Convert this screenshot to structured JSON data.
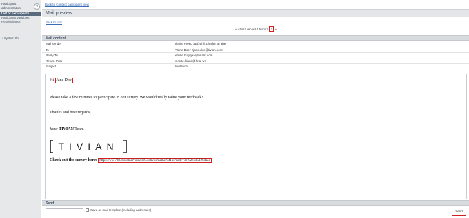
{
  "sidebar": {
    "items": [
      {
        "label": "Participant"
      },
      {
        "label": "administration"
      },
      {
        "label": "List of participants"
      },
      {
        "label": "Participant variables"
      },
      {
        "label": "Results import"
      }
    ],
    "collapse_label": "«",
    "system_label": "› System Ifo"
  },
  "header": {
    "back_contact": "Back to Contact participant view",
    "title": "Mail preview",
    "back_list": "Back to lists"
  },
  "pager": {
    "first": "«",
    "prev": "‹",
    "text": "Data record 1 from 2",
    "next": "›",
    "last": "»"
  },
  "mail_content": {
    "title": "Mail content",
    "rows": [
      {
        "label": "Mail sender",
        "value": "Illarile Freed\"ap@di li, Lhaifpr wi  ahe"
      },
      {
        "label": "To",
        "value": "\"Jane Doe\" <jane.doe@tivian.com>"
      },
      {
        "label": "Reply-To",
        "value": "emilie.bugitjaa@hr.am com"
      },
      {
        "label": "Return-Path",
        "value": "c rarte.hlaue@hr.ai ws"
      },
      {
        "label": "Subject",
        "value": "Invitation"
      }
    ]
  },
  "body": {
    "greeting_prefix": "Hi",
    "greeting_name": "Jane Doe",
    "para1": "Please take a few minutes to participate in our survey. We would really value your feedback!",
    "para2": "Thanks and best regards,",
    "sign_prefix": "Your ",
    "sign_bold": "TIVIAN",
    "sign_suffix": " Team",
    "logo_text": "TIVIAN",
    "survey_label": "Check out the survey here:",
    "survey_link": "https://ws3738.customervoice360.com/uc/name/941a/?code=3ef02cod5126daac"
  },
  "send": {
    "title": "Send",
    "checkbox_label": "Save as mail template (including addresses)",
    "button_label": "Send"
  }
}
